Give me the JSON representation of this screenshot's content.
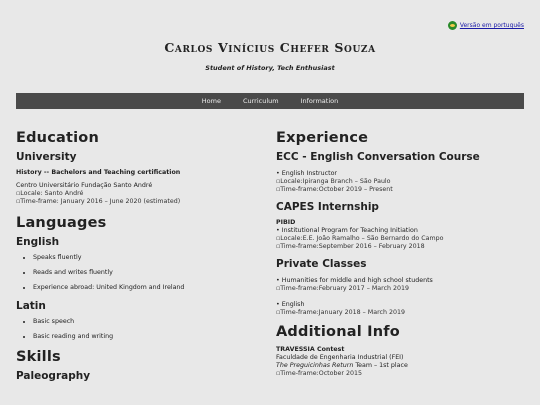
{
  "lang_link": "Versão em português",
  "name": "Carlos Vinícius Chefer Souza",
  "subtitle": "Student of History, Tech Enthusiast",
  "nav": [
    "Home",
    "Curriculum",
    "Information"
  ],
  "education": {
    "heading": "Education",
    "sub": "University",
    "degree": "History -- Bachelors and Teaching certification",
    "institution": "Centro Universitário Fundação Santo André",
    "locale": "Locale: Santo André",
    "timeframe": "Time-frame: January 2016 – June 2020 (estimated)"
  },
  "languages": {
    "heading": "Languages",
    "english": {
      "title": "English",
      "items": [
        "Speaks fluently",
        "Reads and writes fluently",
        "Experience abroad: United Kingdom and Ireland"
      ]
    },
    "latin": {
      "title": "Latin",
      "items": [
        "Basic speech",
        "Basic reading and writing"
      ]
    }
  },
  "skills": {
    "heading": "Skills",
    "sub": "Paleography"
  },
  "experience": {
    "heading": "Experience",
    "ecc": {
      "title": "ECC - English Conversation Course",
      "role": "English Instructor",
      "locale": "Locale:Ipiranga Branch – São Paulo",
      "timeframe": "Time-frame:October 2019 – Present"
    },
    "capes": {
      "title": "CAPES Internship",
      "program": "PIBID",
      "desc": "Institutional Program for Teaching Initiation",
      "locale": "Locale:E.E. João Ramalho – São Bernardo do Campo",
      "timeframe": "Time-frame:September 2016 – February 2018"
    },
    "private": {
      "title": "Private Classes",
      "item1": "Humanities for middle and high school students",
      "tf1": "Time-frame:February 2017 – March 2019",
      "item2": "English",
      "tf2": "Time-frame:January 2018 – March 2019"
    }
  },
  "additional": {
    "heading": "Additional Info",
    "contest": "TRAVESSIA Contest",
    "faculty": "Faculdade de Engenharia Industrial (FEI)",
    "team_name": "The Preguicinhas Return",
    "team_rest": " Team – 1st place",
    "timeframe": "Time-frame:October 2015"
  }
}
